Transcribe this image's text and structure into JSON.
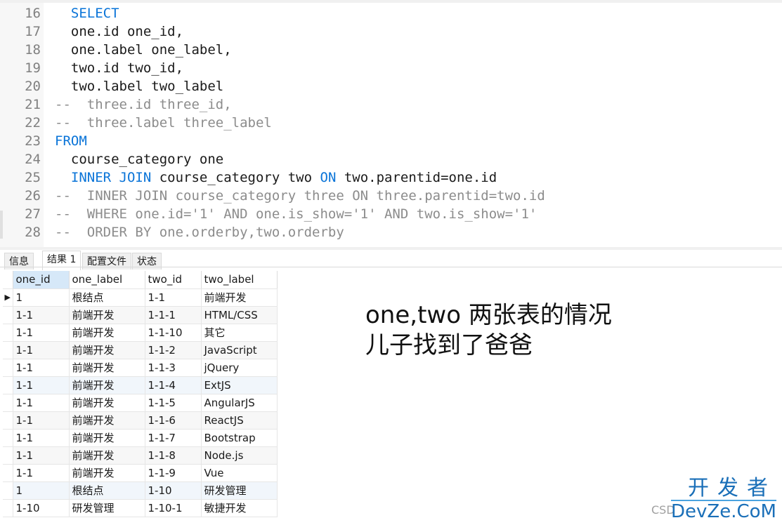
{
  "editor": {
    "lines": [
      {
        "n": "16",
        "parts": [
          {
            "t": "  ",
            "c": ""
          },
          {
            "t": "SELECT",
            "c": "kw"
          }
        ]
      },
      {
        "n": "17",
        "parts": [
          {
            "t": "  one.id one_id,",
            "c": ""
          }
        ]
      },
      {
        "n": "18",
        "parts": [
          {
            "t": "  one.label one_label,",
            "c": ""
          }
        ]
      },
      {
        "n": "19",
        "parts": [
          {
            "t": "  two.id two_id,",
            "c": ""
          }
        ]
      },
      {
        "n": "20",
        "parts": [
          {
            "t": "  two.label two_label",
            "c": ""
          }
        ]
      },
      {
        "n": "21",
        "parts": [
          {
            "t": "--  three.id three_id,",
            "c": "cm"
          }
        ]
      },
      {
        "n": "22",
        "parts": [
          {
            "t": "--  three.label three_label",
            "c": "cm"
          }
        ]
      },
      {
        "n": "23",
        "parts": [
          {
            "t": "FROM",
            "c": "kw"
          }
        ]
      },
      {
        "n": "24",
        "parts": [
          {
            "t": "  course_category one",
            "c": ""
          }
        ]
      },
      {
        "n": "25",
        "parts": [
          {
            "t": "  ",
            "c": ""
          },
          {
            "t": "INNER JOIN",
            "c": "kw"
          },
          {
            "t": " course_category two ",
            "c": ""
          },
          {
            "t": "ON",
            "c": "kw"
          },
          {
            "t": " two.parentid=one.id",
            "c": ""
          }
        ]
      },
      {
        "n": "26",
        "parts": [
          {
            "t": "--  INNER JOIN course_category three ON three.parentid=two.id",
            "c": "cm"
          }
        ]
      },
      {
        "n": "27",
        "parts": [
          {
            "t": "--  WHERE one.id='1' AND one.is_show='1' AND two.is_show='1'",
            "c": "cm"
          }
        ]
      },
      {
        "n": "28",
        "parts": [
          {
            "t": "--  ORDER BY one.orderby,two.orderby",
            "c": "cm"
          }
        ]
      }
    ]
  },
  "tabs": [
    {
      "label": "信息",
      "active": false
    },
    {
      "label": "结果 1",
      "active": true
    },
    {
      "label": "配置文件",
      "active": false
    },
    {
      "label": "状态",
      "active": false
    }
  ],
  "result": {
    "columns": [
      "one_id",
      "one_label",
      "two_id",
      "two_label"
    ],
    "current_row_marker": "▶",
    "rows": [
      [
        "1",
        "根结点",
        "1-1",
        "前端开发"
      ],
      [
        "1-1",
        "前端开发",
        "1-1-1",
        "HTML/CSS"
      ],
      [
        "1-1",
        "前端开发",
        "1-1-10",
        "其它"
      ],
      [
        "1-1",
        "前端开发",
        "1-1-2",
        "JavaScript"
      ],
      [
        "1-1",
        "前端开发",
        "1-1-3",
        "jQuery"
      ],
      [
        "1-1",
        "前端开发",
        "1-1-4",
        "ExtJS"
      ],
      [
        "1-1",
        "前端开发",
        "1-1-5",
        "AngularJS"
      ],
      [
        "1-1",
        "前端开发",
        "1-1-6",
        "ReactJS"
      ],
      [
        "1-1",
        "前端开发",
        "1-1-7",
        "Bootstrap"
      ],
      [
        "1-1",
        "前端开发",
        "1-1-8",
        "Node.js"
      ],
      [
        "1-1",
        "前端开发",
        "1-1-9",
        "Vue"
      ],
      [
        "1",
        "根结点",
        "1-10",
        "研发管理"
      ],
      [
        "1-10",
        "研发管理",
        "1-10-1",
        "敏捷开发"
      ]
    ]
  },
  "annotation": {
    "line1": "one,two 两张表的情况",
    "line2": "儿子找到了爸爸"
  },
  "watermark": {
    "top": "开发者",
    "bottom": "DevZe.CoM",
    "prefix": "CSD"
  },
  "colors": {
    "keyword": "#0a74d8",
    "comment": "#8c8c8c",
    "header_selected": "#d6e8f8",
    "watermark": "#1a6fb8"
  }
}
